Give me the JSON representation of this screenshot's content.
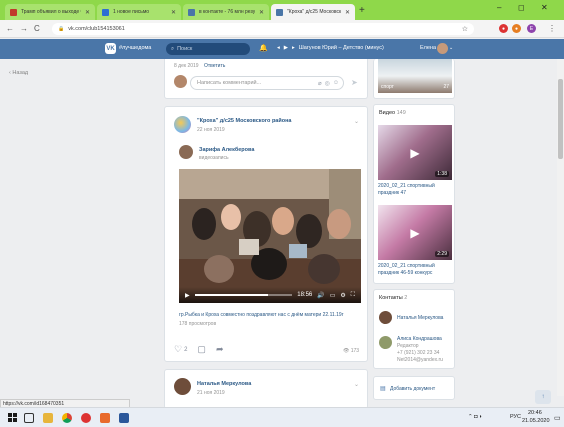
{
  "browser": {
    "tabs": [
      {
        "label": "Трамп объявил о выходе США",
        "active": false,
        "fav": "#c0392b"
      },
      {
        "label": "1 новое письмо",
        "active": false,
        "fav": "#2d6fd3"
      },
      {
        "label": "в контакте - 76 млн результат",
        "active": false,
        "fav": "#4a76a8"
      },
      {
        "label": "\"Кроха\" д/с25 Московского ра",
        "active": true,
        "fav": "#4a76a8"
      }
    ],
    "new_tab": "+",
    "window_controls": [
      "–",
      "◻",
      "✕"
    ],
    "nav": {
      "back": "←",
      "forward": "→",
      "reload": "C"
    },
    "url": "vk.com/club154153061",
    "lock": "🔒",
    "star": "☆"
  },
  "vk": {
    "brand": "#лучшедома",
    "search_placeholder": "Поиск",
    "bell": "🔔",
    "player": {
      "prev": "◂",
      "play": "▶",
      "next": "▸",
      "track": "Шагунов Юрий – Детство (минус)"
    },
    "user_name": "Елена",
    "chevron": "⌄"
  },
  "sidebar": {
    "back_label": "Назад"
  },
  "top_post": {
    "date": "8 дек 2019",
    "reply": "Ответить",
    "comment_placeholder": "Написать комментарий..."
  },
  "post": {
    "group": "\"Кроха\" д/с25 Московского района",
    "date": "22 ноя 2019",
    "author": "Зарифа Алекберова",
    "author_sub": "видеозапись",
    "video_time": "18:56",
    "video_progress": 0.75,
    "video_title": "гр.Рыбка и Кроха совместно поздравляют нас с днём матери 22.11.19г",
    "video_views": "178 просмотров",
    "likes": "2",
    "views_icon": "👁",
    "views": "173"
  },
  "next_post": {
    "author": "Наталья Меркулова",
    "date": "21 ноя 2019"
  },
  "right": {
    "top_thumb_label": "спорт",
    "top_thumb_count": "27",
    "videos_title": "Видео",
    "videos_count": "149",
    "videos": [
      {
        "caption": "2020_02_21 спортивный праздник 47",
        "duration": "1:38"
      },
      {
        "caption": "2020_02_21 спортивный праздник 46-59 конкурс",
        "duration": "2:29"
      }
    ],
    "contacts_title": "Контакты",
    "contacts_count": "2",
    "contacts": [
      {
        "name": "Наталья Меркулова",
        "lines": []
      },
      {
        "name": "Алиса Кондрашова",
        "lines": [
          "Редактор",
          "+7 (921) 302 23 34",
          "Net2014@yandex.ru"
        ]
      }
    ],
    "add_doc": "Добавить документ"
  },
  "status_url": "https://vk.com/id168470351",
  "taskbar": {
    "tray_lang": "РУС",
    "time": "20:46",
    "date": "21.05.2020"
  },
  "colors": {
    "vk_blue": "#4a76a8",
    "link": "#2a5885",
    "tab_green": "#8fd84a"
  }
}
